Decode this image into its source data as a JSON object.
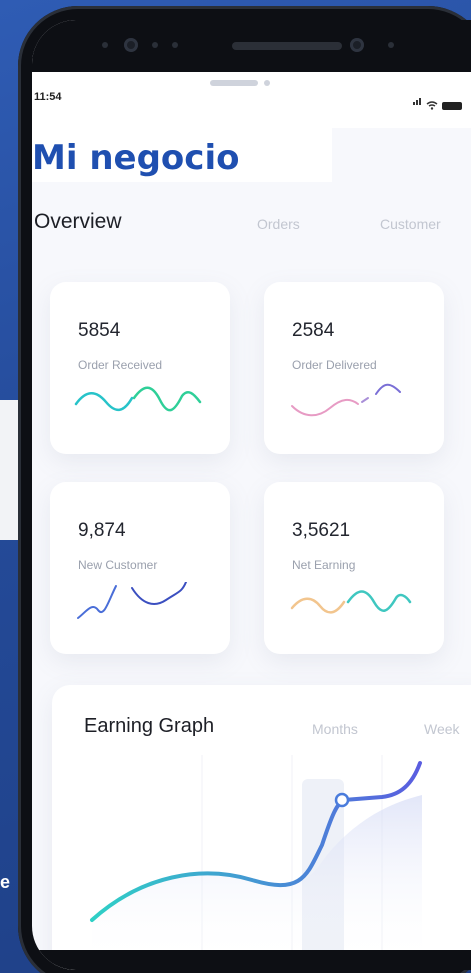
{
  "status_bar": {
    "time": "11:54"
  },
  "header": {
    "title": "Mi negocio"
  },
  "tabs": [
    {
      "label": "Overview",
      "active": true
    },
    {
      "label": "Orders",
      "active": false
    },
    {
      "label": "Customer",
      "active": false
    }
  ],
  "cards": [
    {
      "value": "5854",
      "label": "Order Received",
      "colors": [
        "#27c3c9",
        "#2fcf98"
      ]
    },
    {
      "value": "2584",
      "label": "Order Delivered",
      "colors": [
        "#e79bc4",
        "#7a6fd6"
      ]
    },
    {
      "value": "9,874",
      "label": "New Customer",
      "colors": [
        "#4a6ed8",
        "#3b4fc0"
      ]
    },
    {
      "value": "3,5621",
      "label": "Net Earning",
      "colors": [
        "#f2c58e",
        "#3fc7c0"
      ]
    }
  ],
  "earning_graph": {
    "title": "Earning Graph",
    "tabs": [
      "Months",
      "Week"
    ],
    "line_colors": [
      "#2fd0c6",
      "#5a5de0"
    ]
  },
  "background": {
    "letter": "e"
  },
  "icons": [
    "signal-icon",
    "wifi-icon",
    "battery-icon"
  ]
}
